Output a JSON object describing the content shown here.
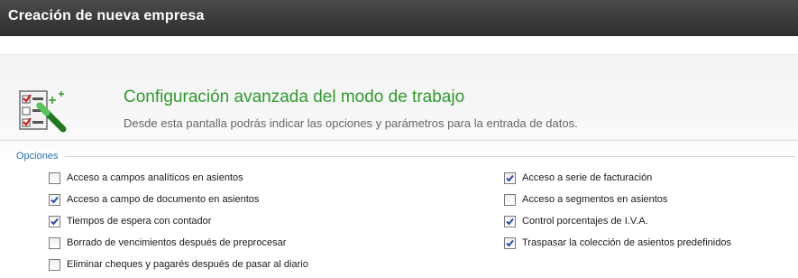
{
  "window": {
    "title": "Creación de nueva empresa"
  },
  "header": {
    "icon": "checklist-wand-icon",
    "title": "Configuración avanzada del modo de trabajo",
    "subtitle": "Desde esta pantalla podrás indicar las opciones y parámetros para la entrada de datos."
  },
  "options": {
    "legend": "Opciones",
    "left": [
      {
        "label": "Acceso a campos analíticos en asientos",
        "checked": false
      },
      {
        "label": "Acceso a campo de documento en asientos",
        "checked": true
      },
      {
        "label": "Tiempos de espera con contador",
        "checked": true
      },
      {
        "label": "Borrado de vencimientos después de preprocesar",
        "checked": false
      },
      {
        "label": "Eliminar cheques y pagarés después de pasar al diario",
        "checked": false
      }
    ],
    "right": [
      {
        "label": "Acceso a serie de facturación",
        "checked": true
      },
      {
        "label": "Acceso a segmentos en asientos",
        "checked": false
      },
      {
        "label": "Control porcentajes de I.V.A.",
        "checked": true
      },
      {
        "label": "Traspasar la colección de asientos predefinidos",
        "checked": true
      }
    ]
  },
  "colors": {
    "titlebar": "#3a3a3a",
    "accent_green": "#2f9b2f",
    "legend_blue": "#2a6fb0",
    "check_blue": "#2b4aa8"
  }
}
